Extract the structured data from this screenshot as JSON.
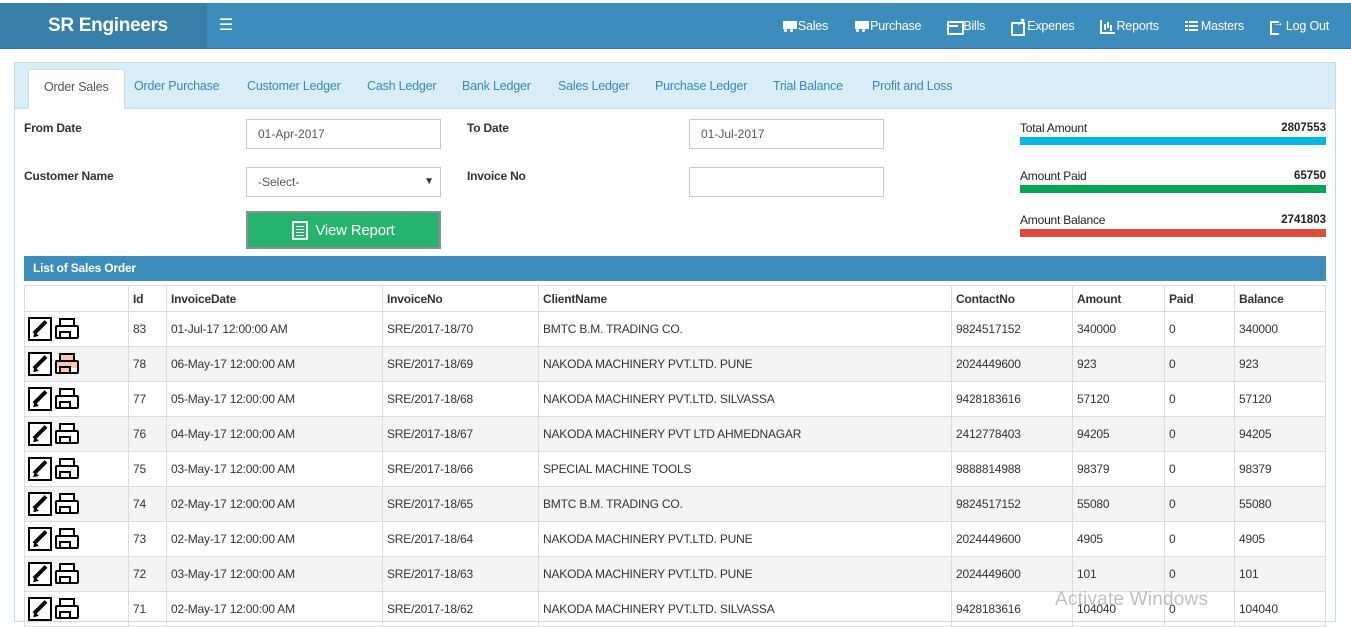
{
  "app": {
    "brand": "SR Engineers"
  },
  "nav": [
    {
      "label": "Sales",
      "icon": "cart-icon"
    },
    {
      "label": "Purchase",
      "icon": "cart-icon"
    },
    {
      "label": "Bills",
      "icon": "bills-icon"
    },
    {
      "label": "Expenes",
      "icon": "external-link-icon"
    },
    {
      "label": "Reports",
      "icon": "bar-chart-icon"
    },
    {
      "label": "Masters",
      "icon": "list-icon"
    },
    {
      "label": "Log Out",
      "icon": "logout-icon"
    }
  ],
  "tabs": [
    "Order Sales",
    "Order Purchase",
    "Customer Ledger",
    "Cash Ledger",
    "Bank Ledger",
    "Sales Ledger",
    "Purchase Ledger",
    "Trial Balance",
    "Profit and Loss"
  ],
  "filters": {
    "from_date_label": "From Date",
    "from_date_value": "01-Apr-2017",
    "to_date_label": "To Date",
    "to_date_value": "01-Jul-2017",
    "customer_label": "Customer Name",
    "customer_value": "-Select-",
    "invoice_label": "Invoice No",
    "invoice_value": "",
    "view_button": "View Report"
  },
  "summary": {
    "total_label": "Total Amount",
    "total_value": "2807553",
    "total_color": "#00b7e4",
    "paid_label": "Amount Paid",
    "paid_value": "65750",
    "paid_color": "#00a651",
    "balance_label": "Amount Balance",
    "balance_value": "2741803",
    "balance_color": "#dd4b39"
  },
  "list": {
    "title": "List of Sales Order",
    "columns": [
      "",
      "Id",
      "InvoiceDate",
      "InvoiceNo",
      "ClientName",
      "ContactNo",
      "Amount",
      "Paid",
      "Balance"
    ],
    "rows": [
      {
        "id": "83",
        "date": "01-Jul-17 12:00:00 AM",
        "invoice": "SRE/2017-18/70",
        "client": "BMTC B.M. TRADING CO.",
        "contact": "9824517152",
        "amount": "340000",
        "paid": "0",
        "balance": "340000"
      },
      {
        "id": "78",
        "date": "06-May-17 12:00:00 AM",
        "invoice": "SRE/2017-18/69",
        "client": "NAKODA MACHINERY PVT.LTD. PUNE",
        "contact": "2024449600",
        "amount": "923",
        "paid": "0",
        "balance": "923"
      },
      {
        "id": "77",
        "date": "05-May-17 12:00:00 AM",
        "invoice": "SRE/2017-18/68",
        "client": "NAKODA MACHINERY PVT.LTD. SILVASSA",
        "contact": "9428183616",
        "amount": "57120",
        "paid": "0",
        "balance": "57120"
      },
      {
        "id": "76",
        "date": "04-May-17 12:00:00 AM",
        "invoice": "SRE/2017-18/67",
        "client": "NAKODA MACHINERY PVT LTD AHMEDNAGAR",
        "contact": "2412778403",
        "amount": "94205",
        "paid": "0",
        "balance": "94205"
      },
      {
        "id": "75",
        "date": "03-May-17 12:00:00 AM",
        "invoice": "SRE/2017-18/66",
        "client": "SPECIAL MACHINE TOOLS",
        "contact": "9888814988",
        "amount": "98379",
        "paid": "0",
        "balance": "98379"
      },
      {
        "id": "74",
        "date": "02-May-17 12:00:00 AM",
        "invoice": "SRE/2017-18/65",
        "client": "BMTC B.M. TRADING CO.",
        "contact": "9824517152",
        "amount": "55080",
        "paid": "0",
        "balance": "55080"
      },
      {
        "id": "73",
        "date": "02-May-17 12:00:00 AM",
        "invoice": "SRE/2017-18/64",
        "client": "NAKODA MACHINERY PVT.LTD. PUNE",
        "contact": "2024449600",
        "amount": "4905",
        "paid": "0",
        "balance": "4905"
      },
      {
        "id": "72",
        "date": "03-May-17 12:00:00 AM",
        "invoice": "SRE/2017-18/63",
        "client": "NAKODA MACHINERY PVT.LTD. PUNE",
        "contact": "2024449600",
        "amount": "101",
        "paid": "0",
        "balance": "101"
      },
      {
        "id": "71",
        "date": "02-May-17 12:00:00 AM",
        "invoice": "SRE/2017-18/62",
        "client": "NAKODA MACHINERY PVT.LTD. SILVASSA",
        "contact": "9428183616",
        "amount": "104040",
        "paid": "0",
        "balance": "104040"
      }
    ]
  },
  "watermark": "Activate Windows"
}
